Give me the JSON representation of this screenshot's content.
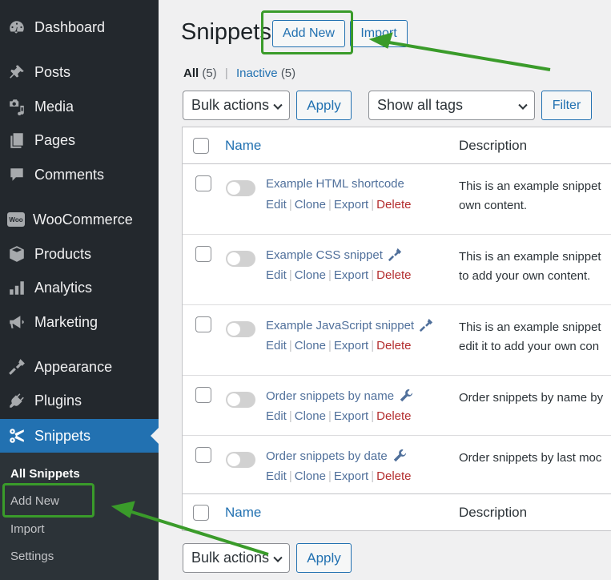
{
  "sidebar": {
    "items": [
      {
        "label": "Dashboard",
        "icon": "dashboard-icon"
      },
      {
        "label": "Posts",
        "icon": "pushpin-icon"
      },
      {
        "label": "Media",
        "icon": "media-icon"
      },
      {
        "label": "Pages",
        "icon": "pages-icon"
      },
      {
        "label": "Comments",
        "icon": "comment-bubble-icon"
      },
      {
        "label": "WooCommerce",
        "icon": "woo-icon"
      },
      {
        "label": "Products",
        "icon": "box-icon"
      },
      {
        "label": "Analytics",
        "icon": "bar-chart-icon"
      },
      {
        "label": "Marketing",
        "icon": "megaphone-icon"
      },
      {
        "label": "Appearance",
        "icon": "paintbrush-icon"
      },
      {
        "label": "Plugins",
        "icon": "plug-icon"
      },
      {
        "label": "Snippets",
        "icon": "scissors-icon",
        "active": true
      }
    ],
    "woo_icon_text": "Woo",
    "submenu": [
      {
        "label": "All Snippets",
        "current": true
      },
      {
        "label": "Add New"
      },
      {
        "label": "Import"
      },
      {
        "label": "Settings"
      }
    ]
  },
  "header": {
    "title": "Snippets",
    "add_new_label": "Add New",
    "import_label": "Import"
  },
  "filters": {
    "all_label": "All",
    "all_count": "(5)",
    "inactive_label": "Inactive",
    "inactive_count": "(5)"
  },
  "tablenav_top": {
    "bulk_actions": "Bulk actions",
    "apply_label": "Apply",
    "tags_select": "Show all tags",
    "filter_label": "Filter"
  },
  "tablenav_bottom": {
    "bulk_actions": "Bulk actions",
    "apply_label": "Apply"
  },
  "table": {
    "columns": {
      "name": "Name",
      "description": "Description"
    },
    "row_actions": {
      "edit": "Edit",
      "clone": "Clone",
      "export": "Export",
      "delete": "Delete",
      "separator": "|"
    },
    "rows": [
      {
        "name": "Example HTML shortcode",
        "type_icon": "",
        "desc_line1": "This is an example snippet",
        "desc_line2": "own content.",
        "active": false
      },
      {
        "name": "Example CSS snippet",
        "type_icon": "paintbrush-icon",
        "desc_line1": "This is an example snippet",
        "desc_line2": "to add your own content.",
        "active": false
      },
      {
        "name": "Example JavaScript snippet",
        "type_icon": "paintbrush-icon",
        "desc_line1": "This is an example snippet",
        "desc_line2": "edit it to add your own con",
        "active": false
      },
      {
        "name": "Order snippets by name",
        "type_icon": "wrench-icon",
        "desc_line1": "Order snippets by name by",
        "desc_line2": "",
        "active": false
      },
      {
        "name": "Order snippets by date",
        "type_icon": "wrench-icon",
        "desc_line1": "Order snippets by last moc",
        "desc_line2": "",
        "active": false
      }
    ]
  },
  "annotations": {
    "highlight_color": "#3a9b2a",
    "highlighted": [
      "Add New (header)",
      "Add New (submenu)"
    ]
  }
}
